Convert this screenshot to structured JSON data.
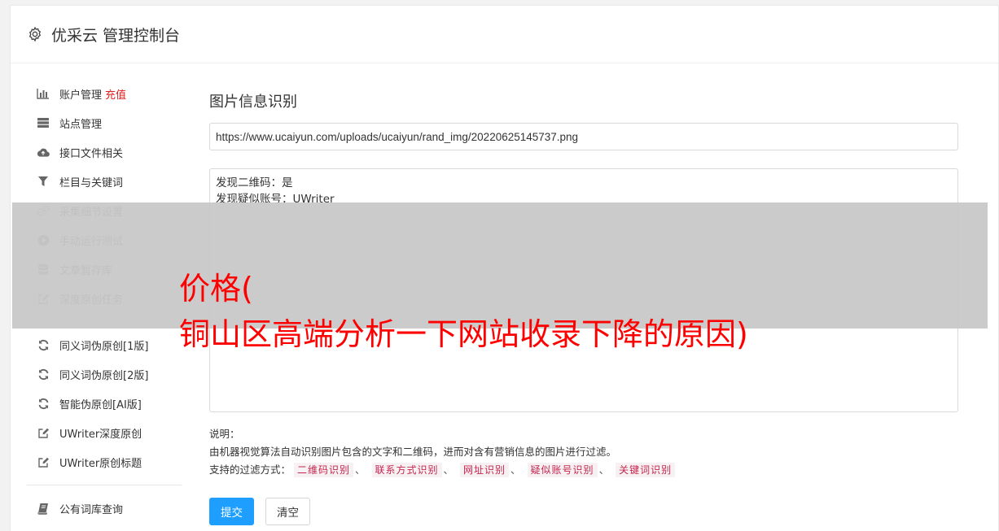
{
  "header": {
    "title": "优采云 管理控制台",
    "icon": "gear-icon"
  },
  "sidebar": {
    "groups": [
      [
        {
          "label": "账户管理",
          "badge": "充值",
          "icon": "bar-chart-icon"
        },
        {
          "label": "站点管理",
          "icon": "server-icon"
        },
        {
          "label": "接口文件相关",
          "icon": "cloud-upload-icon"
        },
        {
          "label": "栏目与关键词",
          "icon": "filter-icon"
        },
        {
          "label": "采集细节设置",
          "icon": "cogs-icon"
        },
        {
          "label": "手动运行测试",
          "icon": "play-icon"
        },
        {
          "label": "文章暂存库",
          "icon": "database-icon"
        },
        {
          "label": "深度原创任务",
          "icon": "edit-icon"
        }
      ],
      [
        {
          "label": "同义词伪原创[1版]",
          "icon": "refresh-icon"
        },
        {
          "label": "同义词伪原创[2版]",
          "icon": "refresh-icon"
        },
        {
          "label": "智能伪原创[AI版]",
          "icon": "refresh-icon"
        },
        {
          "label": "UWriter深度原创",
          "icon": "edit-icon"
        },
        {
          "label": "UWriter原创标题",
          "icon": "edit-icon"
        }
      ],
      [
        {
          "label": "公有词库查询",
          "icon": "book-icon"
        }
      ]
    ]
  },
  "main": {
    "title": "图片信息识别",
    "url_value": "https://www.ucaiyun.com/uploads/ucaiyun/rand_img/20220625145737.png",
    "result_lines": [
      "发现二维码：是",
      "发现疑似账号：UWriter"
    ],
    "desc_label": "说明：",
    "desc_text": "由机器视觉算法自动识别图片包含的文字和二维码，进而对含有营销信息的图片进行过滤。",
    "filter_label": "支持的过滤方式：",
    "filters": [
      "二维码识别",
      "联系方式识别",
      "网址识别",
      "疑似账号识别",
      "关键词识别"
    ],
    "filter_sep": "、",
    "submit_label": "提交",
    "clear_label": "清空"
  },
  "overlay": {
    "line1": "价格(",
    "line2": "铜山区高端分析一下网站收录下降的原因)"
  },
  "colors": {
    "primary": "#1e9fff",
    "badge": "#e02020",
    "tag_text": "#c7254e",
    "overlay_text": "#ff0000"
  }
}
